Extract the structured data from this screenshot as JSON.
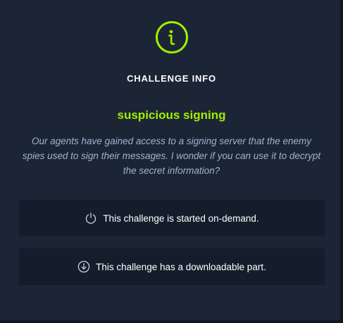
{
  "section_title": "CHALLENGE INFO",
  "challenge": {
    "name": "suspicious signing",
    "description": "Our agents have gained access to a signing server that the enemy spies used to sign their messages. I wonder if you can use it to decrypt the secret information?"
  },
  "features": [
    {
      "icon": "power-icon",
      "label": "This challenge is started on-demand."
    },
    {
      "icon": "download-icon",
      "label": "This challenge has a downloadable part."
    }
  ],
  "colors": {
    "accent": "#9fef00",
    "background": "#1c2536",
    "card": "#141d2b",
    "description_text": "#a4b1cd"
  }
}
